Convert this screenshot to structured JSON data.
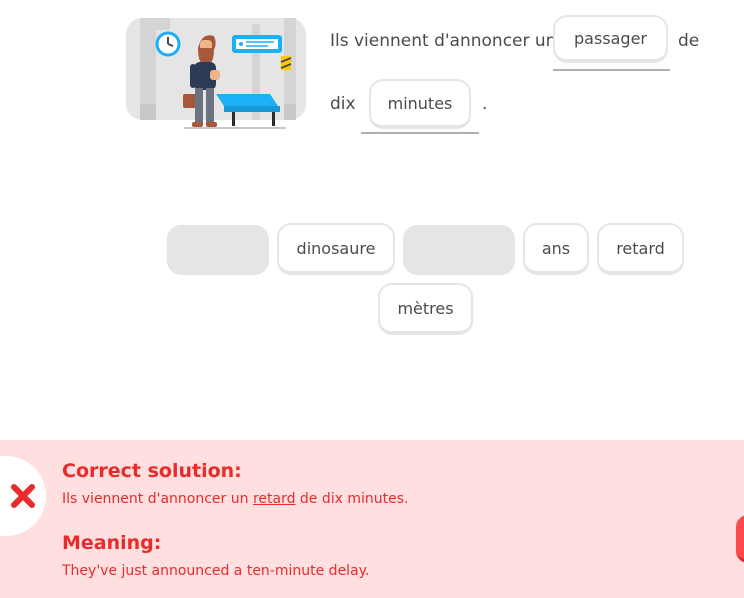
{
  "prompt": {
    "line1_text": "Ils viennent d'annoncer un",
    "after_first_blank": "de",
    "line2_text": "dix",
    "period": "."
  },
  "filled_answers": [
    "passager",
    "minutes"
  ],
  "word_bank": [
    "dinosaure",
    "ans",
    "retard",
    "mètres"
  ],
  "feedback": {
    "solution_heading": "Correct solution:",
    "solution_before": "Ils viennent d'annoncer un ",
    "solution_highlight": "retard",
    "solution_after": " de dix minutes.",
    "meaning_heading": "Meaning:",
    "meaning_text": "They've just announced a ten-minute delay."
  },
  "colors": {
    "error_red": "#ea2b2b",
    "error_background": "#ffdfe0",
    "chip_border": "#e5e5e5",
    "bench_blue": "#1cb0f6"
  },
  "icons": {
    "illustration": "train-station-man-illustration",
    "status": "close-icon"
  }
}
